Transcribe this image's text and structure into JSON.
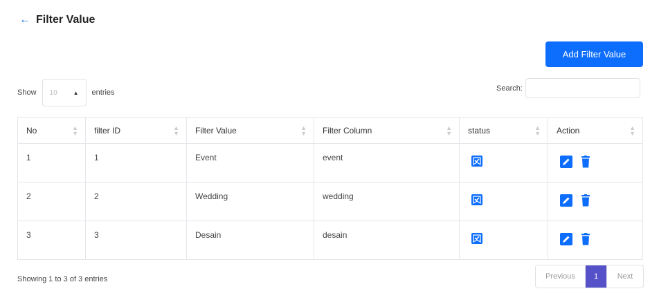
{
  "page": {
    "title": "Filter Value",
    "add_button": "Add Filter Value"
  },
  "controls": {
    "show_label": "Show",
    "length_value": "10",
    "entries_label": "entries",
    "search_label": "Search:"
  },
  "table": {
    "headers": [
      "No",
      "filter ID",
      "Filter Value",
      "Filter Column",
      "status",
      "Action"
    ],
    "rows": [
      {
        "no": "1",
        "filter_id": "1",
        "filter_value": "Event",
        "filter_column": "event"
      },
      {
        "no": "2",
        "filter_id": "2",
        "filter_value": "Wedding",
        "filter_column": "wedding"
      },
      {
        "no": "3",
        "filter_id": "3",
        "filter_value": "Desain",
        "filter_column": "desain"
      }
    ]
  },
  "footer": {
    "info": "Showing 1 to 3 of 3 entries",
    "previous": "Previous",
    "current_page": "1",
    "next": "Next"
  },
  "icons": {
    "back": "arrow-left-icon",
    "status": "check-badge-icon",
    "edit": "edit-icon",
    "delete": "trash-icon",
    "sort": "sort-icon"
  },
  "colors": {
    "primary": "#0d6efd",
    "pagination_active": "#5552c9"
  }
}
